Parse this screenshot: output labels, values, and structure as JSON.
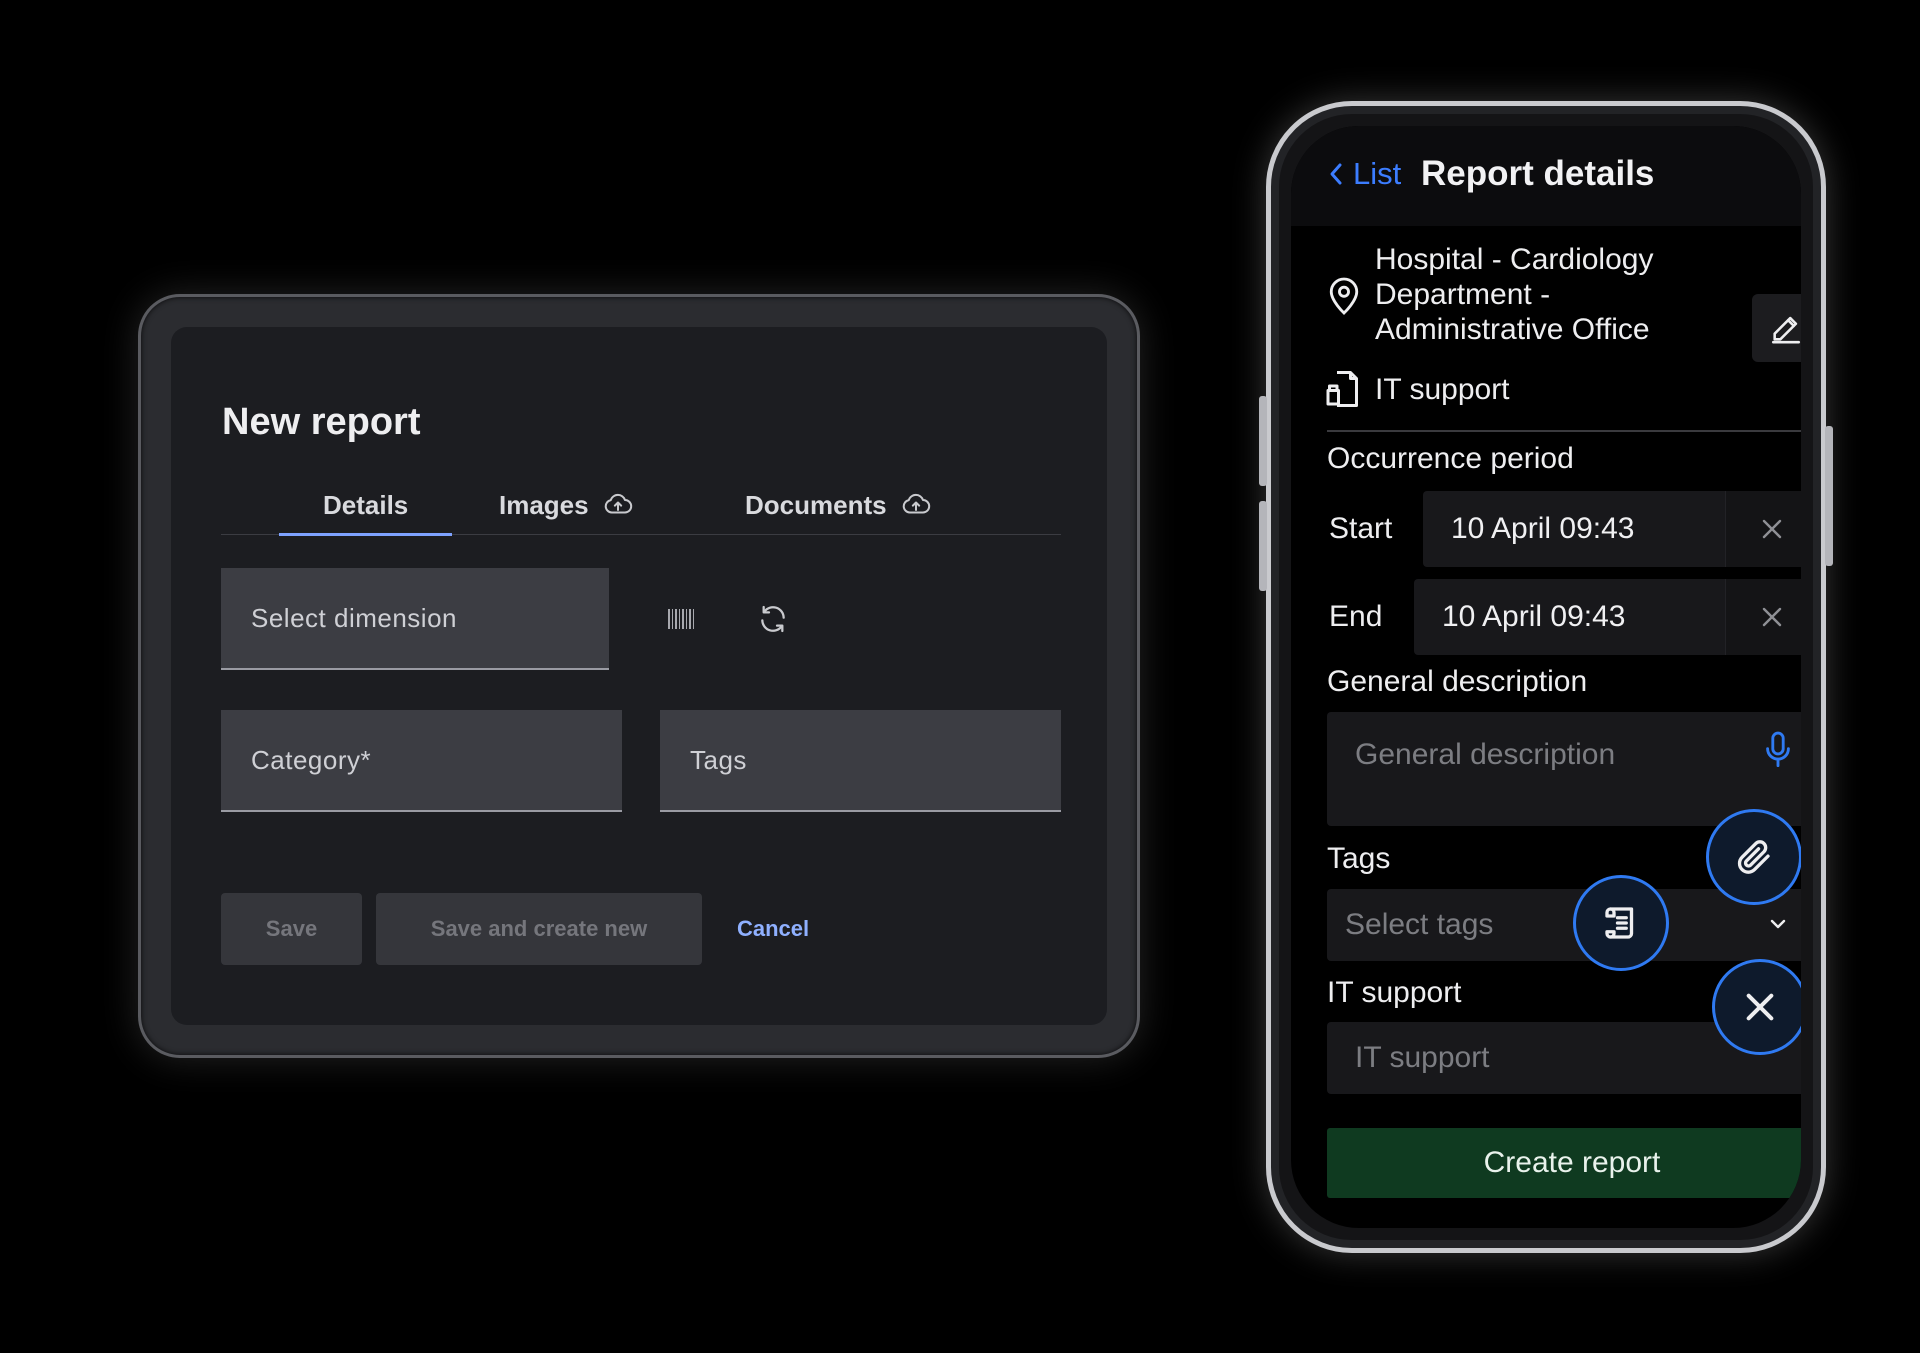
{
  "tablet": {
    "title": "New report",
    "tabs": [
      {
        "label": "Details",
        "active": true
      },
      {
        "label": "Images",
        "icon": "cloud-upload-icon"
      },
      {
        "label": "Documents",
        "icon": "cloud-upload-icon"
      }
    ],
    "fields": {
      "dimension": "Select dimension",
      "category": "Category*",
      "tags": "Tags"
    },
    "buttons": {
      "save": "Save",
      "save_new": "Save and create new",
      "cancel": "Cancel"
    }
  },
  "phone": {
    "back_label": "List",
    "title": "Report details",
    "location": [
      "Hospital - Cardiology",
      "Department  -",
      "Administrative Office"
    ],
    "category": "IT support",
    "occurrence": {
      "heading": "Occurrence period",
      "start_label": "Start",
      "start_value": "10 April 09:43",
      "end_label": "End",
      "end_value": "10 April 09:43"
    },
    "description": {
      "heading": "General description",
      "placeholder": "General description"
    },
    "tags": {
      "heading": "Tags",
      "placeholder": "Select tags"
    },
    "it_support": {
      "heading": "IT support",
      "placeholder": "IT support"
    },
    "cta": "Create report"
  },
  "colors": {
    "accent_blue": "#3c7dff",
    "tab_underline": "#7ea2ff",
    "cta_green": "#0f3a20",
    "fab_border": "#2f7af2"
  }
}
